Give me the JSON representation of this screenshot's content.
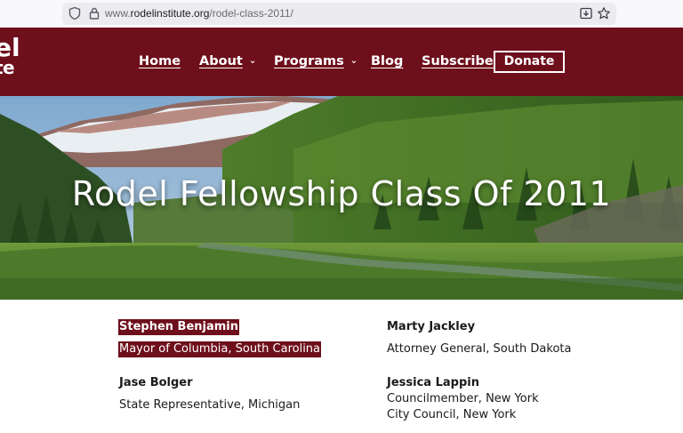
{
  "browser": {
    "url_prefix": "www.",
    "url_host": "rodelinstitute.org",
    "url_path": "/rodel-class-2011/"
  },
  "header": {
    "logo_line1": "el",
    "logo_line2": "te",
    "nav": [
      {
        "label": "Home",
        "dropdown": false
      },
      {
        "label": "About",
        "dropdown": true
      },
      {
        "label": "Programs",
        "dropdown": true
      },
      {
        "label": "Blog",
        "dropdown": false
      },
      {
        "label": "Subscribe",
        "dropdown": false
      }
    ],
    "donate_label": "Donate"
  },
  "hero": {
    "title": "Rodel Fellowship Class Of 2011"
  },
  "fellows": [
    {
      "name": "Stephen Benjamin",
      "role": "Mayor of Columbia, South Carolina",
      "highlighted": true
    },
    {
      "name": "Marty Jackley",
      "role": "Attorney General, South Dakota",
      "highlighted": false
    },
    {
      "name": "Jase Bolger",
      "role": "State Representative, Michigan",
      "highlighted": false
    },
    {
      "name": "Jessica Lappin",
      "role": "Councilmember, New York City Council, New York",
      "highlighted": false
    }
  ],
  "colors": {
    "brand": "#6e0f1c",
    "text": "#1a1a1a"
  }
}
